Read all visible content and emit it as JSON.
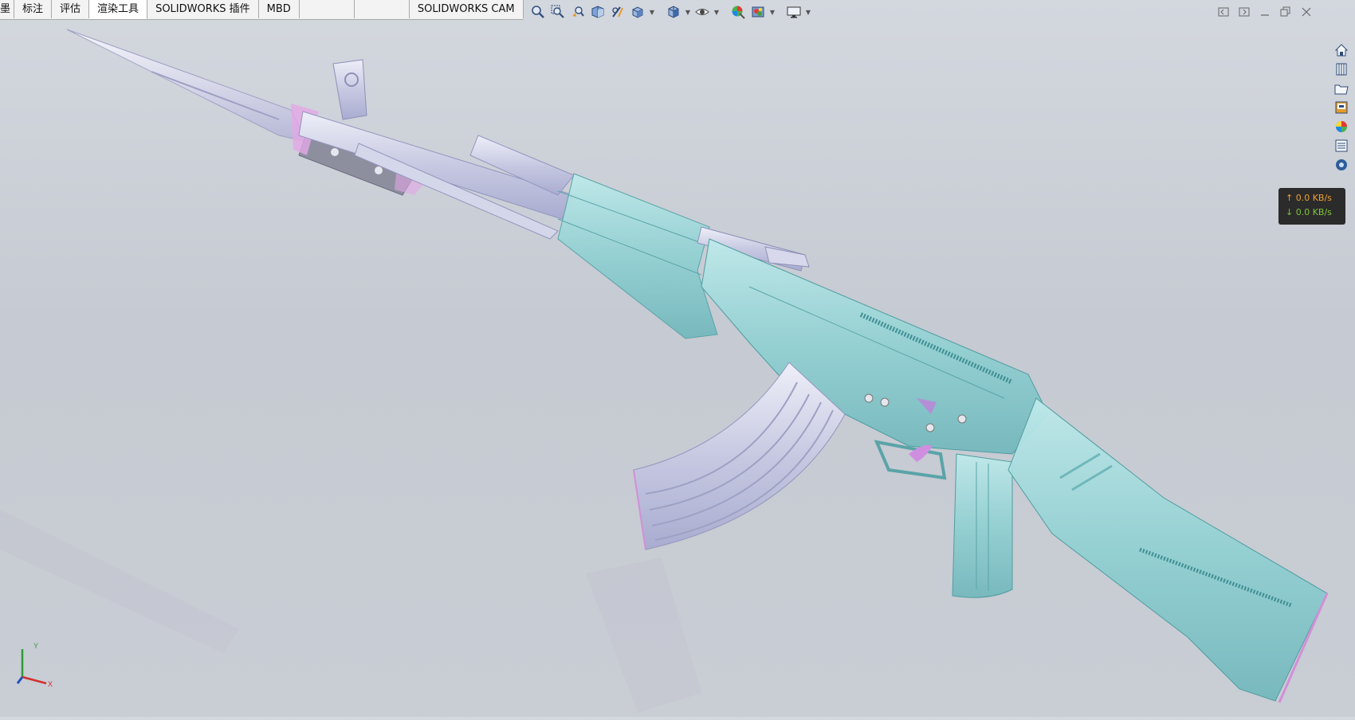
{
  "ribbon": {
    "tabs": [
      {
        "label": "墨",
        "active": false
      },
      {
        "label": "标注",
        "active": false
      },
      {
        "label": "评估",
        "active": false
      },
      {
        "label": "渲染工具",
        "active": true
      },
      {
        "label": "SOLIDWORKS 插件",
        "active": false
      },
      {
        "label": "MBD",
        "active": false
      },
      {
        "label": "",
        "active": false
      },
      {
        "label": "",
        "active": false
      },
      {
        "label": "SOLIDWORKS CAM",
        "active": false
      }
    ]
  },
  "heads_up_toolbar": {
    "icons": [
      "zoom-to-fit-icon",
      "zoom-to-area-icon",
      "previous-view-icon",
      "section-view-icon",
      "dynamic-annotation-icon",
      "view-orientation-icon",
      "display-style-icon",
      "hide-show-items-icon",
      "edit-appearance-icon",
      "apply-scene-icon",
      "view-settings-icon"
    ]
  },
  "window_controls": [
    "restore-left-icon",
    "restore-right-icon",
    "minimize-icon",
    "tile-icon",
    "close-icon"
  ],
  "task_pane": [
    "home-icon",
    "design-library-icon",
    "file-explorer-icon",
    "view-palette-icon",
    "appearances-icon",
    "custom-properties-icon",
    "solidworks-forum-icon"
  ],
  "network_speed": {
    "upload": "↑ 0.0 KB/s",
    "download": "↓ 0.0 KB/s"
  },
  "triad": {
    "y_label": "Y",
    "x_label": "X"
  },
  "colors": {
    "viewport_bg": "#c9cdd4",
    "body_teal": "#8fd0d2",
    "metal_lavender": "#c7c9e2",
    "accent_pink": "#e3a7e6"
  }
}
